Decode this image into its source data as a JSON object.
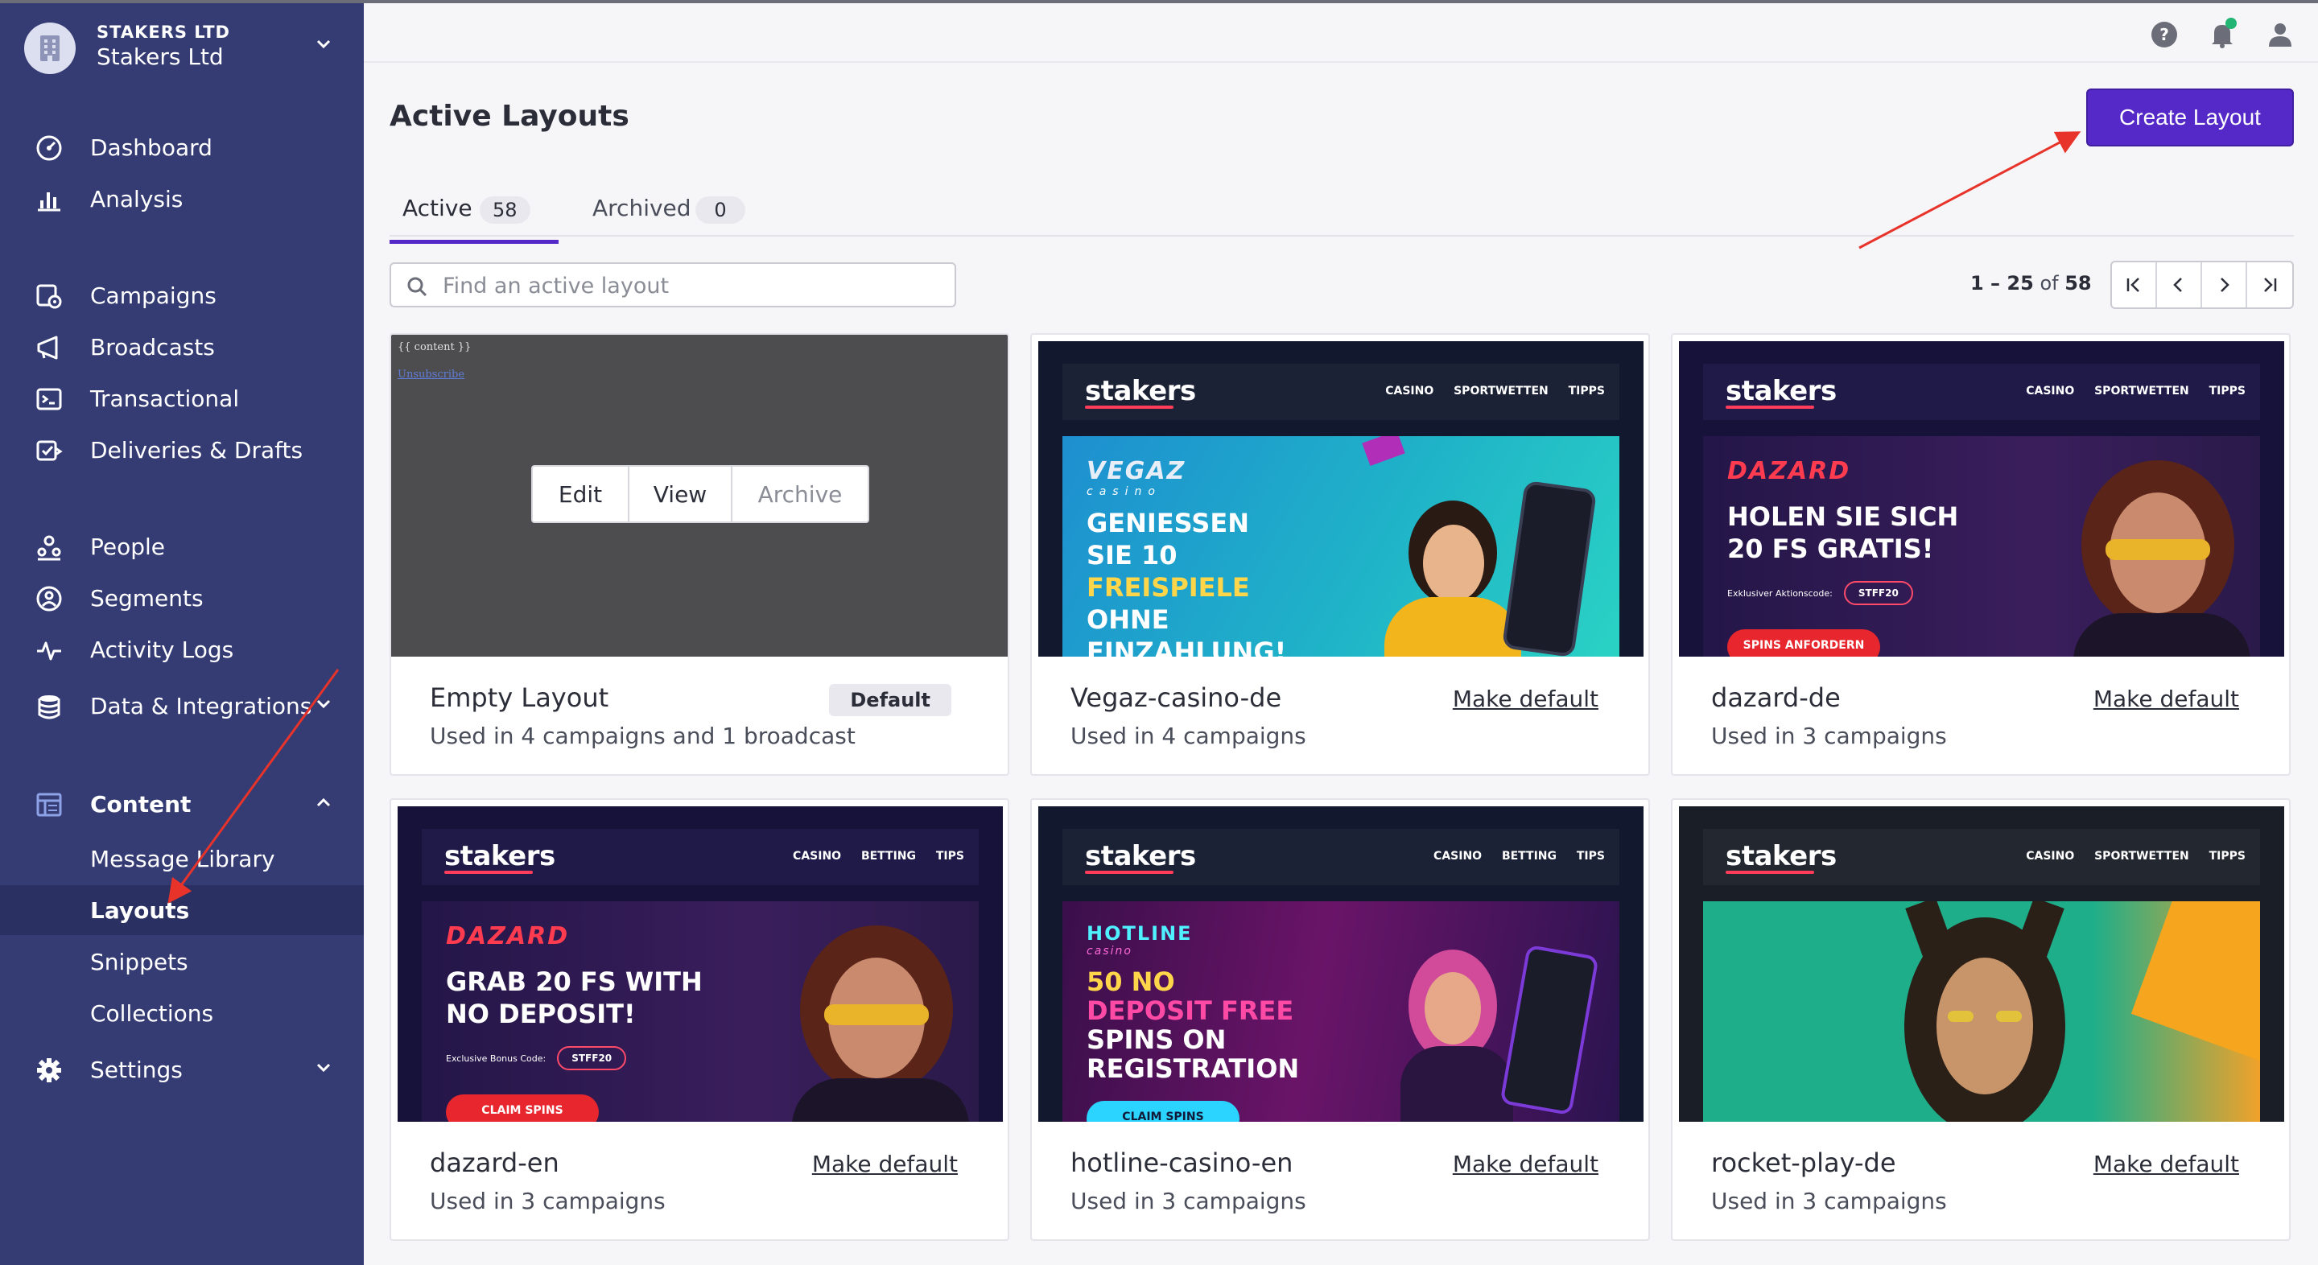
{
  "org": {
    "caption": "STAKERS LTD",
    "name": "Stakers Ltd",
    "icon": "building-icon"
  },
  "sidebar": {
    "items": [
      {
        "label": "Dashboard",
        "icon": "dashboard-gauge-icon"
      },
      {
        "label": "Analysis",
        "icon": "bar-chart-icon"
      },
      {
        "label": "Campaigns",
        "icon": "campaigns-icon"
      },
      {
        "label": "Broadcasts",
        "icon": "megaphone-icon"
      },
      {
        "label": "Transactional",
        "icon": "terminal-icon"
      },
      {
        "label": "Deliveries & Drafts",
        "icon": "deliveries-icon"
      },
      {
        "label": "People",
        "icon": "people-icon"
      },
      {
        "label": "Segments",
        "icon": "segments-icon"
      },
      {
        "label": "Activity Logs",
        "icon": "pulse-icon"
      },
      {
        "label": "Data & Integrations",
        "icon": "database-icon"
      },
      {
        "label": "Content",
        "icon": "content-layout-icon"
      },
      {
        "label": "Message Library"
      },
      {
        "label": "Layouts"
      },
      {
        "label": "Snippets"
      },
      {
        "label": "Collections"
      },
      {
        "label": "Settings",
        "icon": "gear-icon"
      }
    ],
    "active": "Layouts"
  },
  "topbar": {
    "icons": [
      "help-icon",
      "bell-icon",
      "user-icon"
    ]
  },
  "page": {
    "title": "Active Layouts",
    "create_button": "Create Layout",
    "tabs": [
      {
        "label": "Active",
        "count": "58"
      },
      {
        "label": "Archived",
        "count": "0"
      }
    ],
    "search_placeholder": "Find an active layout",
    "pagination": {
      "range": "1 – 25",
      "of": "of",
      "total": "58"
    }
  },
  "cards": [
    {
      "name": "Empty Layout",
      "used": "Used in 4 campaigns and 1 broadcast",
      "badge": "Default",
      "preview": {
        "template_tag": "{{ content }}",
        "unsubscribe": "Unsubscribe"
      },
      "actions": [
        "Edit",
        "View",
        "Archive"
      ]
    },
    {
      "name": "Vegaz-casino-de",
      "used": "Used in 4 campaigns",
      "action": "Make default",
      "preview": {
        "logo": "stakers",
        "menu": "CASINO SPORTWETTEN TIPPS",
        "brand": "VEGAZ",
        "brand_sub": "casino",
        "lines": [
          "GENIESSEN",
          "SIE 10",
          "FREISPIELE",
          "OHNE",
          "EINZAHLUNG!"
        ]
      }
    },
    {
      "name": "dazard-de",
      "used": "Used in 3 campaigns",
      "action": "Make default",
      "preview": {
        "logo": "stakers",
        "menu": "CASINO SPORTWETTEN TIPPS",
        "brand": "DAZARD",
        "lines": [
          "HOLEN SIE SICH",
          "20 FS GRATIS!"
        ],
        "code_label": "Exklusiver Aktionscode:",
        "code": "STFF20",
        "cta": "SPINS ANFORDERN"
      }
    },
    {
      "name": "dazard-en",
      "used": "Used in 3 campaigns",
      "action": "Make default",
      "preview": {
        "logo": "stakers",
        "menu": "CASINO BETTING TIPS",
        "brand": "DAZARD",
        "lines": [
          "GRAB 20 FS WITH",
          "NO DEPOSIT!"
        ],
        "code_label": "Exclusive Bonus Code:",
        "code": "STFF20",
        "cta": "CLAIM SPINS"
      }
    },
    {
      "name": "hotline-casino-en",
      "used": "Used in 3 campaigns",
      "action": "Make default",
      "preview": {
        "logo": "stakers",
        "menu": "CASINO BETTING TIPS",
        "brand": "HOTLINE",
        "brand_sub": "casino",
        "lines": [
          "50 NO",
          "DEPOSIT FREE",
          "SPINS ON",
          "REGISTRATION"
        ],
        "cta": "CLAIM SPINS"
      }
    },
    {
      "name": "rocket-play-de",
      "used": "Used in 3 campaigns",
      "action": "Make default",
      "preview": {
        "logo": "stakers",
        "menu": "CASINO SPORTWETTEN TIPPS"
      }
    }
  ],
  "colors": {
    "sidebar": "#353c74",
    "sidebar_active": "#2a3062",
    "primary": "#5528c8",
    "annotation_arrow": "#e8332b"
  }
}
